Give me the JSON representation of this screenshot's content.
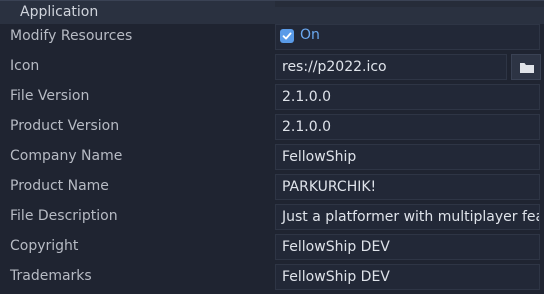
{
  "section": {
    "title": "Application"
  },
  "rows": [
    {
      "label": "Modify Resources",
      "value": "On"
    },
    {
      "label": "Icon",
      "value": "res://p2022.ico"
    },
    {
      "label": "File Version",
      "value": "2.1.0.0"
    },
    {
      "label": "Product Version",
      "value": "2.1.0.0"
    },
    {
      "label": "Company Name",
      "value": "FellowShip"
    },
    {
      "label": "Product Name",
      "value": "PARKURCHIK!"
    },
    {
      "label": "File Description",
      "value": "Just a platformer with multiplayer fea"
    },
    {
      "label": "Copyright",
      "value": "FellowShip DEV"
    },
    {
      "label": "Trademarks",
      "value": "FellowShip DEV"
    }
  ],
  "icons": {
    "checkbox": "checkmark-icon",
    "browse": "folder-icon"
  },
  "colors": {
    "accent": "#5a9be8",
    "background": "#1f2431",
    "field": "#222837"
  }
}
